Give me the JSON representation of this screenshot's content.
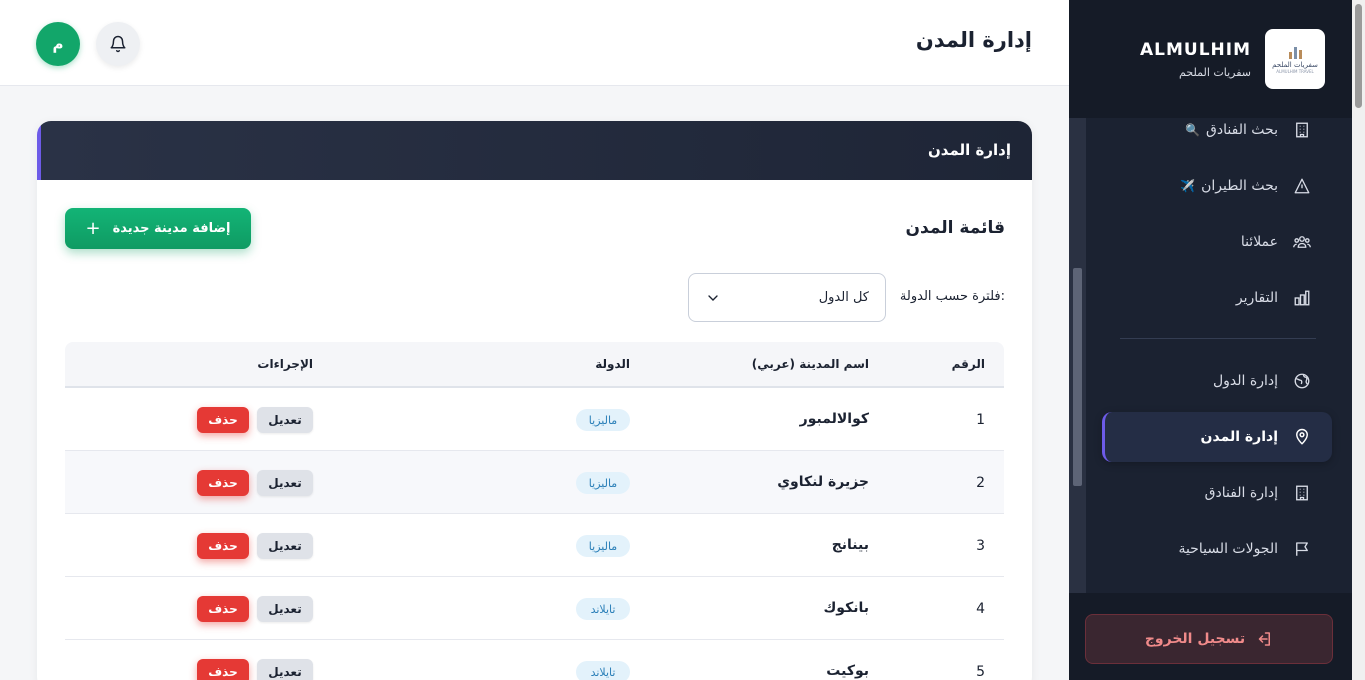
{
  "brand": {
    "name": "ALMULHIM",
    "subtitle": "سفريات الملحم",
    "logo_text": "سفريات الملحم",
    "logo_subtext": "ALMULHIM TRAVEL"
  },
  "sidebar": {
    "items": [
      {
        "label": "بحث الفنادق",
        "emoji": "🔍",
        "icon": "building-icon"
      },
      {
        "label": "بحث الطيران",
        "emoji": "✈️",
        "icon": "navigation-icon"
      },
      {
        "label": "عملائنا",
        "icon": "users-icon"
      },
      {
        "label": "التقارير",
        "icon": "bar-chart-icon"
      },
      {
        "label": "إدارة الدول",
        "icon": "globe-icon"
      },
      {
        "label": "إدارة المدن",
        "icon": "map-pin-icon",
        "active": true
      },
      {
        "label": "إدارة الفنادق",
        "icon": "building-icon"
      },
      {
        "label": "الجولات السياحية",
        "icon": "flag-icon"
      }
    ],
    "logout_label": "تسجيل الخروج"
  },
  "header": {
    "title": "إدارة المدن",
    "avatar_initial": "م"
  },
  "card": {
    "title": "إدارة المدن",
    "list_title": "قائمة المدن",
    "add_button": "إضافة مدينة جديدة",
    "filter_label": "فلترة حسب الدولة:",
    "filter_value": "كل الدول"
  },
  "table": {
    "headers": {
      "number": "الرقم",
      "city_name": "اسم المدينة (عربي)",
      "country": "الدولة",
      "actions": "الإجراءات"
    },
    "edit_label": "تعديل",
    "delete_label": "حذف",
    "rows": [
      {
        "number": "1",
        "city": "كوالالمبور",
        "country": "ماليزيا"
      },
      {
        "number": "2",
        "city": "جزيرة لنكاوي",
        "country": "ماليزيا"
      },
      {
        "number": "3",
        "city": "بينانج",
        "country": "ماليزيا"
      },
      {
        "number": "4",
        "city": "بانكوك",
        "country": "تايلاند"
      },
      {
        "number": "5",
        "city": "بوكيت",
        "country": "تايلاند"
      }
    ]
  },
  "colors": {
    "sidebar_bg": "#1b2231",
    "accent_green": "#12a66a",
    "accent_purple": "#6d5be8",
    "danger_red": "#e53935",
    "badge_blue": "#2a7fb8"
  }
}
